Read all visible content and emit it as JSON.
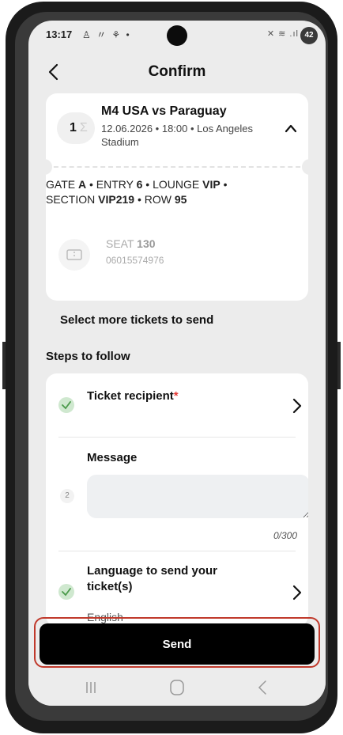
{
  "status_bar": {
    "time": "13:17",
    "left_icons": "♙ 〃 ⚘ •",
    "right_icons": "✕ ≋ .ıl",
    "battery": "42"
  },
  "header": {
    "title": "Confirm",
    "back_icon": "chevron-left-icon"
  },
  "ticket": {
    "count": "1",
    "match_title": "M4 USA vs Paraguay",
    "match_details": "12.06.2026 • 18:00 • Los Angeles Stadium",
    "gate_label": "GATE",
    "gate_value": "A",
    "entry_label": "ENTRY",
    "entry_value": "6",
    "lounge_label": "LOUNGE",
    "lounge_value": "VIP",
    "section_label": "SECTION",
    "section_value": "VIP219",
    "row_label": "ROW",
    "row_value": "95",
    "seat_label": "SEAT",
    "seat_value": "130",
    "seat_code": "06015574976"
  },
  "more_tickets_label": "Select more tickets to send",
  "steps": {
    "title": "Steps to follow",
    "recipient": {
      "label": "Ticket recipient",
      "required_mark": "*"
    },
    "message": {
      "step_number": "2",
      "label": "Message",
      "value": "",
      "placeholder": "",
      "counter": "0/300"
    },
    "language": {
      "label": "Language to send your ticket(s)",
      "value": "English"
    }
  },
  "send_button_label": "Send",
  "nav": [
    "recent-apps-icon",
    "home-icon",
    "back-icon"
  ],
  "colors": {
    "accent_check": "#cfe8cf",
    "required": "#e53935",
    "highlight_border": "#c0392b",
    "primary_button": "#000000"
  }
}
